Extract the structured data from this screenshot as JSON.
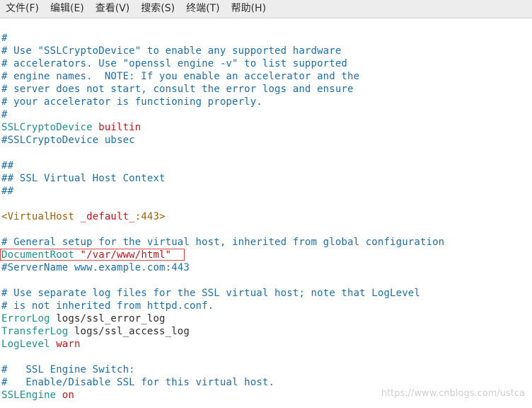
{
  "menu": {
    "items": [
      "文件(F)",
      "编辑(E)",
      "查看(V)",
      "搜索(S)",
      "终端(T)",
      "帮助(H)"
    ]
  },
  "editor": {
    "lines": [
      {
        "segments": [
          {
            "t": "#",
            "c": "comment"
          }
        ]
      },
      {
        "segments": [
          {
            "t": "# Use \"SSLCryptoDevice\" to enable any supported hardware",
            "c": "comment"
          }
        ]
      },
      {
        "segments": [
          {
            "t": "# accelerators. Use \"openssl engine -v\" to list supported",
            "c": "comment"
          }
        ]
      },
      {
        "segments": [
          {
            "t": "# engine names.  NOTE: If you enable an accelerator and the",
            "c": "comment"
          }
        ]
      },
      {
        "segments": [
          {
            "t": "# server does not start, consult the error logs and ensure",
            "c": "comment"
          }
        ]
      },
      {
        "segments": [
          {
            "t": "# your accelerator is functioning properly.",
            "c": "comment"
          }
        ]
      },
      {
        "segments": [
          {
            "t": "#",
            "c": "comment"
          }
        ]
      },
      {
        "segments": [
          {
            "t": "SSLCryptoDevice ",
            "c": "keyword"
          },
          {
            "t": "builtin",
            "c": "value"
          }
        ]
      },
      {
        "segments": [
          {
            "t": "#SSLCryptoDevice ubsec",
            "c": "comment"
          }
        ]
      },
      {
        "segments": []
      },
      {
        "segments": [
          {
            "t": "##",
            "c": "comment"
          }
        ]
      },
      {
        "segments": [
          {
            "t": "## SSL Virtual Host Context",
            "c": "comment"
          }
        ]
      },
      {
        "segments": [
          {
            "t": "##",
            "c": "comment"
          }
        ]
      },
      {
        "segments": []
      },
      {
        "segments": [
          {
            "t": "<VirtualHost ",
            "c": "tag"
          },
          {
            "t": "_default_",
            "c": "value"
          },
          {
            "t": ":443>",
            "c": "tag"
          }
        ]
      },
      {
        "segments": []
      },
      {
        "segments": [
          {
            "t": "# General setup for the virtual host, inherited from global configuration",
            "c": "comment"
          }
        ]
      },
      {
        "segments": [
          {
            "t": "DocumentRoot ",
            "c": "keyword"
          },
          {
            "t": "\"/var/www/html\"",
            "c": "value"
          }
        ]
      },
      {
        "segments": [
          {
            "t": "#ServerName www.example.com:443",
            "c": "comment"
          }
        ]
      },
      {
        "segments": []
      },
      {
        "segments": [
          {
            "t": "# Use separate log files for the SSL virtual host; note that LogLevel",
            "c": "comment"
          }
        ]
      },
      {
        "segments": [
          {
            "t": "# is not inherited from httpd.conf.",
            "c": "comment"
          }
        ]
      },
      {
        "segments": [
          {
            "t": "ErrorLog ",
            "c": "keyword"
          },
          {
            "t": "logs/ssl_error_log",
            "c": "plain"
          }
        ]
      },
      {
        "segments": [
          {
            "t": "TransferLog ",
            "c": "keyword"
          },
          {
            "t": "logs/ssl_access_log",
            "c": "plain"
          }
        ]
      },
      {
        "segments": [
          {
            "t": "LogLevel ",
            "c": "keyword"
          },
          {
            "t": "warn",
            "c": "value"
          }
        ]
      },
      {
        "segments": []
      },
      {
        "segments": [
          {
            "t": "#   SSL Engine Switch:",
            "c": "comment"
          }
        ]
      },
      {
        "segments": [
          {
            "t": "#   Enable/Disable SSL for this virtual host.",
            "c": "comment"
          }
        ]
      },
      {
        "segments": [
          {
            "t": "SSLEngine ",
            "c": "keyword"
          },
          {
            "t": "on",
            "c": "value"
          }
        ]
      }
    ]
  },
  "watermark": "https://www.cnblogs.com/ustca",
  "colors": {
    "comment": "#1d6fa5",
    "keyword": "#17958d",
    "value": "#c3181f",
    "tag": "#a36100",
    "highlight_border": "#e24b4b",
    "menubar_bg": "#ededed"
  }
}
